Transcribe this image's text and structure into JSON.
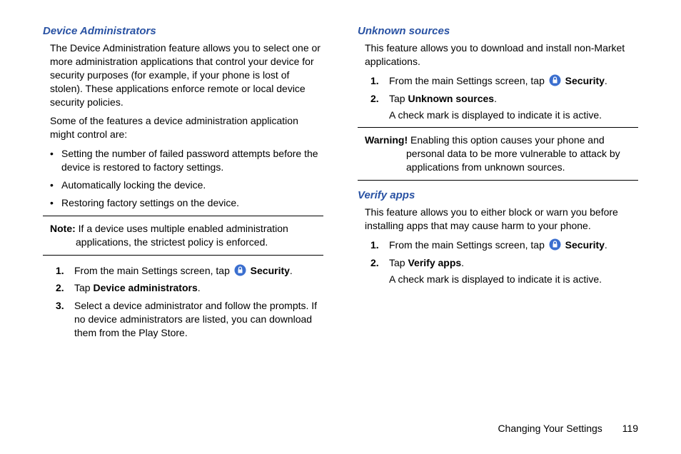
{
  "left": {
    "h_device_admins": "Device Administrators",
    "p1": "The Device Administration feature allows you to select one or more administration applications that control your device for security purposes (for example, if your phone is lost of stolen). These applications enforce remote or local device security policies.",
    "p2": "Some of the features a device administration application might control are:",
    "bullets": {
      "b1": "Setting the number of failed password attempts before the device is restored to factory settings.",
      "b2": "Automatically locking the device.",
      "b3": "Restoring factory settings on the device."
    },
    "note_label": "Note:",
    "note_text": "If a device uses multiple enabled administration applications, the strictest policy is enforced.",
    "step1a": "From the main Settings screen, tap ",
    "step1b": " Security",
    "step1c": ".",
    "step2a": "Tap ",
    "step2b": "Device administrators",
    "step2c": ".",
    "step3": "Select a device administrator and follow the prompts. If no device administrators are listed, you can download them from the Play Store."
  },
  "right": {
    "h_unknown": "Unknown sources",
    "p_unknown": "This feature allows you to download and install non-Market applications.",
    "u_step1a": "From the main Settings screen, tap ",
    "u_step1b": " Security",
    "u_step1c": ".",
    "u_step2a": "Tap ",
    "u_step2b": "Unknown sources",
    "u_step2c": ".",
    "u_step2_sub": "A check mark is displayed to indicate it is active.",
    "warn_label": "Warning!",
    "warn_text": " Enabling this option causes your phone and personal data to be more vulnerable to attack by applications from unknown sources.",
    "h_verify": "Verify apps",
    "p_verify": "This feature allows you to either block or warn you before installing apps that may cause harm to your phone.",
    "v_step1a": "From the main Settings screen, tap ",
    "v_step1b": " Security",
    "v_step1c": ".",
    "v_step2a": "Tap ",
    "v_step2b": "Verify apps",
    "v_step2c": ".",
    "v_step2_sub": "A check mark is displayed to indicate it is active."
  },
  "footer": {
    "title": "Changing Your Settings",
    "page": "119"
  }
}
